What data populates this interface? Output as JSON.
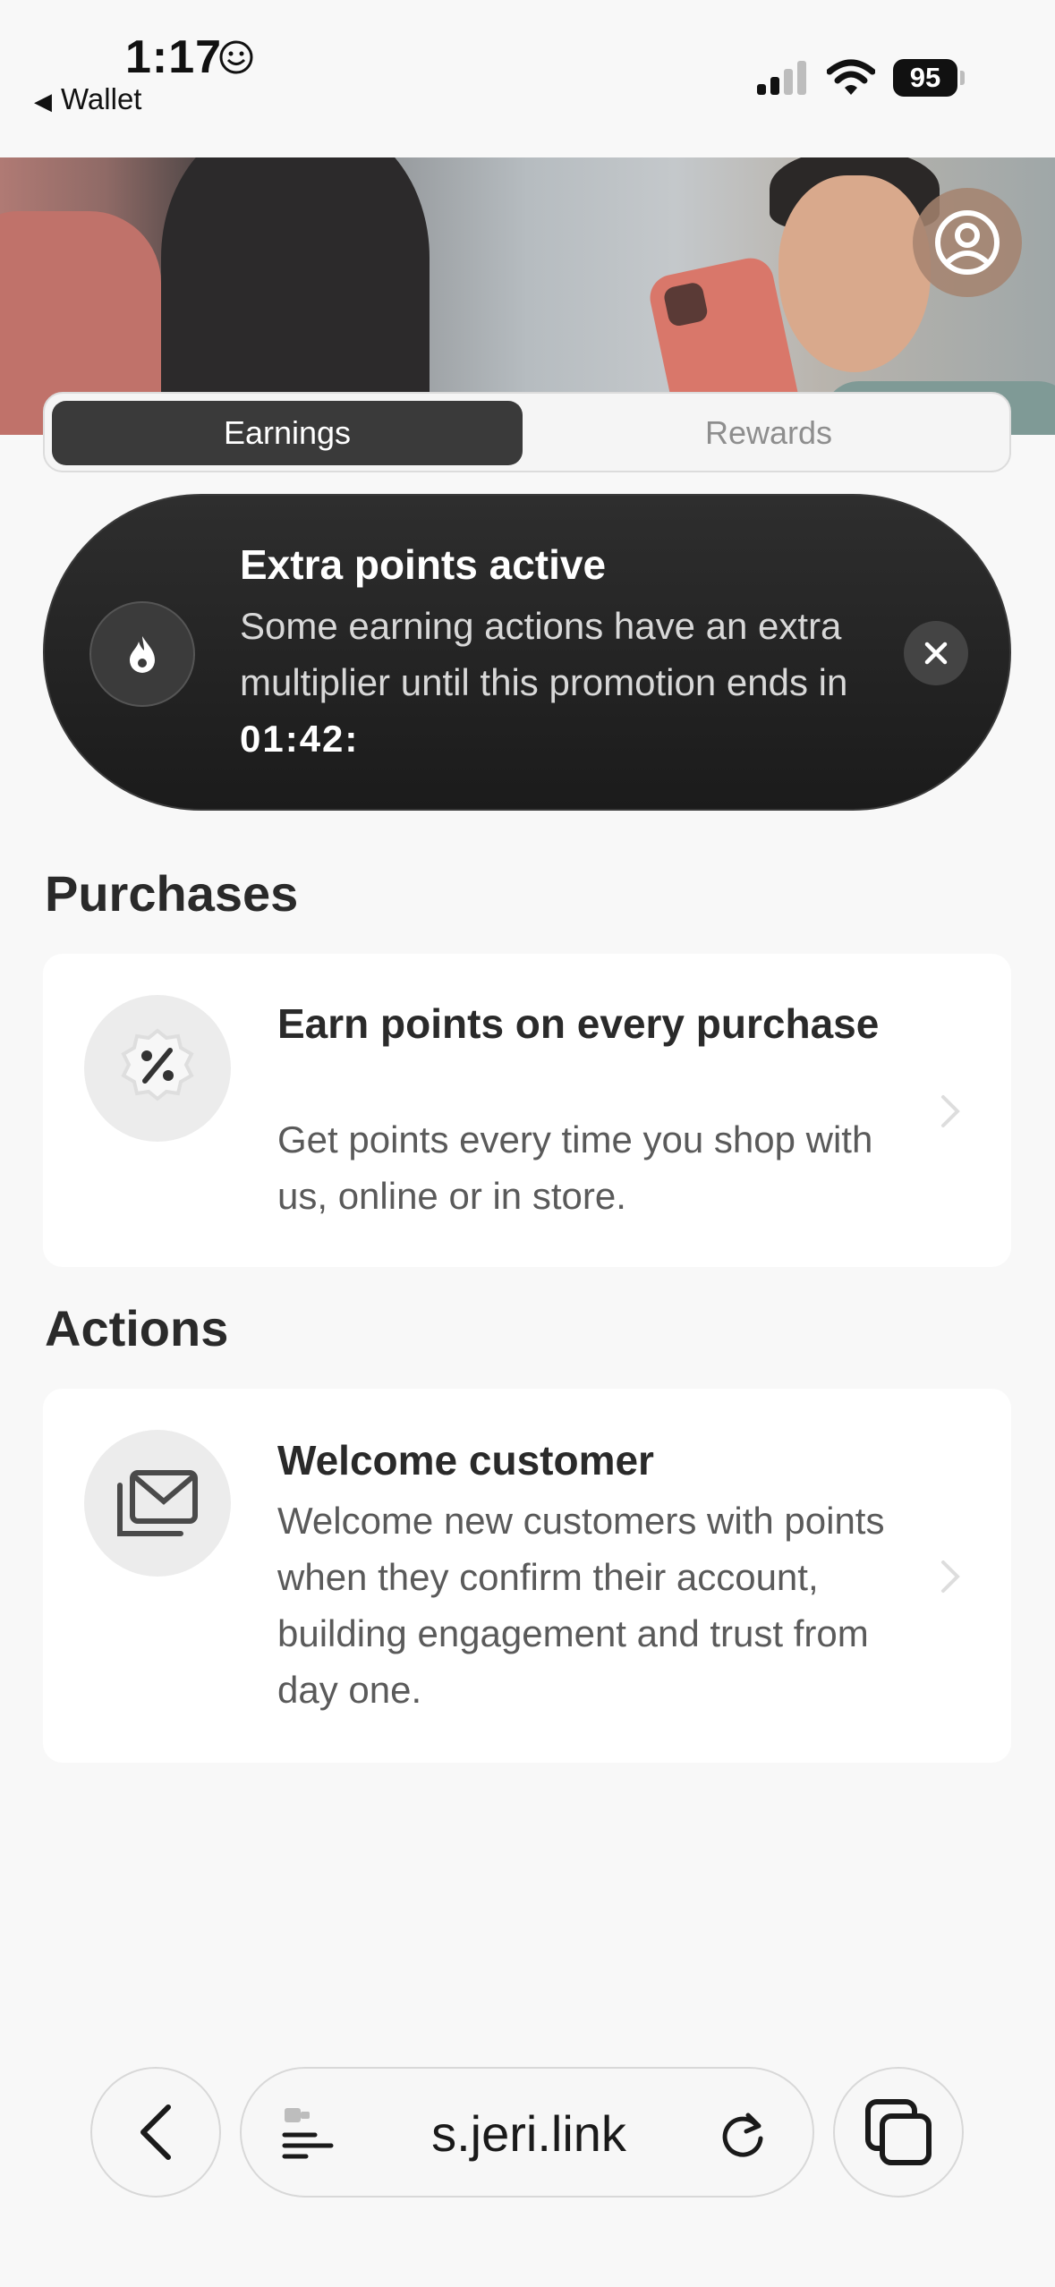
{
  "status_bar": {
    "time": "1:17",
    "back_app": "Wallet",
    "battery": "95"
  },
  "tabs": {
    "active": "Earnings",
    "inactive": "Rewards"
  },
  "promo": {
    "title": "Extra points active",
    "text": "Some earning actions have an extra multiplier until this promotion ends in",
    "timer": "01:42:"
  },
  "purchases": {
    "heading": "Purchases",
    "card": {
      "title": "Earn points on every purchase",
      "text": "Get points every time you shop with us, online or in store."
    }
  },
  "actions": {
    "heading": "Actions",
    "card": {
      "title": "Welcome customer",
      "text": "Welcome new customers with points when they confirm their account, building engagement and trust from day one."
    }
  },
  "browser": {
    "url": "s.jeri.link"
  }
}
